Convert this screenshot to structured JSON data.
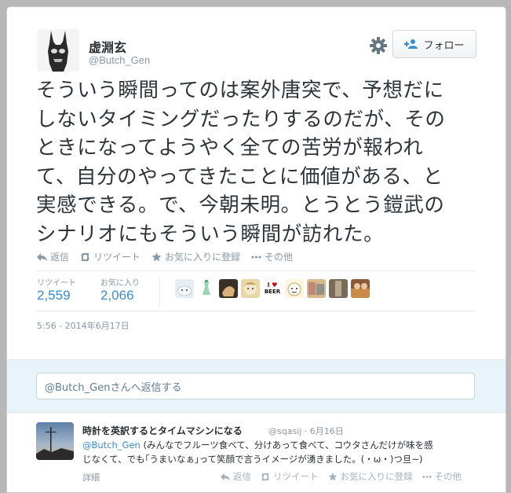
{
  "tweet": {
    "user_name": "虚淵玄",
    "handle": "@Butch_Gen",
    "follow_label": "フォロー",
    "text_lines": [
      "そういう瞬間ってのは案外唐突で、予想だに",
      "しないタイミングだったりするのだが、その",
      "ときになってようやく全ての苦労が報われ",
      "て、自分のやってきたことに価値がある、と",
      "実感できる。で、今朝未明。とうとう鎧武の",
      "シナリオにもそういう瞬間が訪れた。"
    ],
    "actions": {
      "reply": "返信",
      "retweet": "リツイート",
      "favorite": "お気に入りに登録",
      "more": "その他"
    },
    "stats": {
      "retweets_label": "リツイート",
      "retweets_value": "2,559",
      "favorites_label": "お気に入り",
      "favorites_value": "2,066"
    },
    "face_texts": {
      "beer_top": "I ♥",
      "beer_bottom": "BEER"
    },
    "timestamp": "5:56 - 2014年6月17日"
  },
  "reply_box": {
    "placeholder": "@Butch_Genさんへ返信する"
  },
  "reply_tweet": {
    "user_name": "時計を英訳するとタイムマシンになる",
    "meta": "@sqasij · 6月16日",
    "mention": "@Butch_Gen",
    "text_line1": " (みんなでフルーツ食べて、分けあって食べて、コウタさんだけが味を感",
    "text_line2": "じなくて、でも｢うまいなぁ｣って笑顔で言うイメージが湧きました。(・ω・)つ旦~)",
    "detail": "詳細",
    "actions": {
      "reply": "返信",
      "retweet": "リツイート",
      "favorite": "お気に入りに登録",
      "more": "その他"
    }
  },
  "colors": {
    "link": "#3a8ccd",
    "muted": "#8899a6",
    "reply_bg": "#e8f3fa"
  }
}
